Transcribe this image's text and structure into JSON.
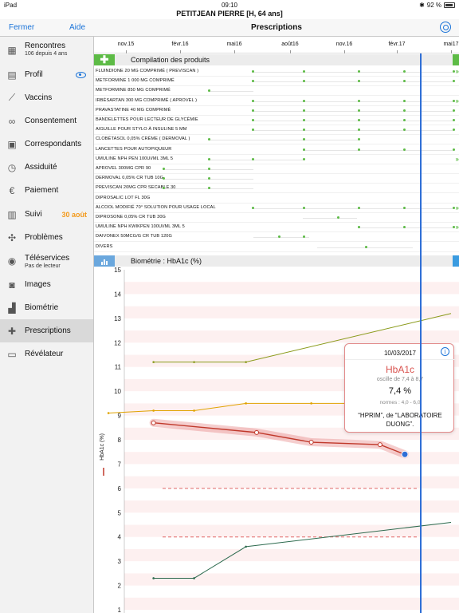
{
  "status": {
    "device": "iPad",
    "time": "09:10",
    "battery": "92 %"
  },
  "patient": "PETITJEAN PIERRE [H, 64 ans]",
  "nav": {
    "close": "Fermer",
    "help": "Aide",
    "title": "Prescriptions"
  },
  "sidebar": {
    "items": [
      {
        "label": "Rencontres",
        "sub": "106 depuis 4 ans",
        "icon": "grid-icon"
      },
      {
        "label": "Profil",
        "icon": "profile-icon"
      },
      {
        "label": "Vaccins",
        "icon": "syringe-icon"
      },
      {
        "label": "Consentement",
        "icon": "handshake-icon"
      },
      {
        "label": "Correspondants",
        "icon": "contacts-icon"
      },
      {
        "label": "Assiduité",
        "icon": "clock-icon"
      },
      {
        "label": "Paiement",
        "icon": "euro-icon"
      },
      {
        "label": "Suivi",
        "badge": "30 août",
        "icon": "calendar-icon"
      },
      {
        "label": "Problèmes",
        "icon": "puzzle-icon"
      },
      {
        "label": "Téléservices",
        "sub": "Pas de lecteur",
        "icon": "card-icon"
      },
      {
        "label": "Images",
        "icon": "camera-icon"
      },
      {
        "label": "Biométrie",
        "icon": "chart-icon"
      },
      {
        "label": "Prescriptions",
        "icon": "cross-icon"
      },
      {
        "label": "Révélateur",
        "icon": "screen-icon"
      }
    ]
  },
  "timeline": {
    "labels": [
      "nov.15",
      "févr.16",
      "mai16",
      "août16",
      "nov.16",
      "févr.17",
      "mai17"
    ]
  },
  "prescriptions": {
    "header": "Compilation des produits",
    "drugs": [
      "FLUINDIONE 20 MG COMPRIMÉ ( PREVISCAN )",
      "METFORMINE 1 000 MG COMPRIMÉ",
      "METFORMINE 850 MG COMPRIMÉ",
      "IRBÉSARTAN 300 MG COMPRIMÉ ( APROVEL )",
      "PRAVASTATINE 40 MG COMPRIMÉ",
      "BANDELETTES POUR LECTEUR DE GLYCÉMIE",
      "AIGUILLE POUR STYLO À INSULINE 5 MM",
      "CLOBÉTASOL 0,05% CRÈME ( DERMOVAL )",
      "LANCETTES POUR AUTOPIQUEUR",
      "UMULINE NPH PEN 100UI/ML 3ML 5",
      "APROVEL 300MG CPR 90",
      "DERMOVAL 0,05% CR TUB 10G",
      "PREVISCAN 20MG CPR SECABLE 30",
      "DIPROSALIC LOT FL 30G",
      "ALCOOL MODIFIÉ 70° SOLUTION POUR USAGE LOCAL",
      "DIPROSONE 0,05% CR TUB 30G",
      "UMULINE NPH KWIKPEN 100UI/ML 3ML 5",
      "DAIVONEX 50MCG/G CR TUB 120G",
      "DIVERS"
    ]
  },
  "biometrie": {
    "header": "Biométrie : HbA1c (%)",
    "ylabel": "HbA1c (%)"
  },
  "chart_data": {
    "type": "line",
    "ylabel": "HbA1c (%)",
    "ylim": [
      1,
      15
    ],
    "yticks": [
      1,
      2,
      3,
      4,
      5,
      6,
      7,
      8,
      9,
      10,
      11,
      12,
      13,
      14,
      15
    ],
    "reference_lines": [
      6.0,
      4.0
    ],
    "series": [
      {
        "name": "HbA1c",
        "color": "#c0392b",
        "x": [
          "2015-12-20",
          "2016-06-20",
          "2016-09-25",
          "2017-01-25",
          "2017-03-10"
        ],
        "values": [
          8.7,
          8.3,
          7.9,
          7.8,
          7.4
        ]
      },
      {
        "color": "#8a9a1a",
        "x": [
          "2015-12-20",
          "2016-03-01",
          "2016-06-01",
          "2017-05-31"
        ],
        "values": [
          11.2,
          11.2,
          11.2,
          13.2
        ]
      },
      {
        "color": "#e0a300",
        "x": [
          "2015-10-01",
          "2015-12-20",
          "2016-03-01",
          "2016-06-01",
          "2016-09-25",
          "2016-12-01",
          "2017-05-31"
        ],
        "values": [
          9.1,
          9.2,
          9.2,
          9.5,
          9.5,
          9.5,
          9.6
        ]
      },
      {
        "color": "#2e6b4f",
        "x": [
          "2015-12-20",
          "2016-03-01",
          "2016-06-01",
          "2017-05-31"
        ],
        "values": [
          2.3,
          2.3,
          3.6,
          4.6
        ]
      }
    ],
    "tooltip": {
      "date": "10/03/2017",
      "title": "HbA1c",
      "range": "oscille de 7,4 à 8,7",
      "value": "7,4 %",
      "norms": "normes : 4,0 - 6,0",
      "source": "“HPRIM”, de “LABORATOIRE DUONG”."
    }
  }
}
